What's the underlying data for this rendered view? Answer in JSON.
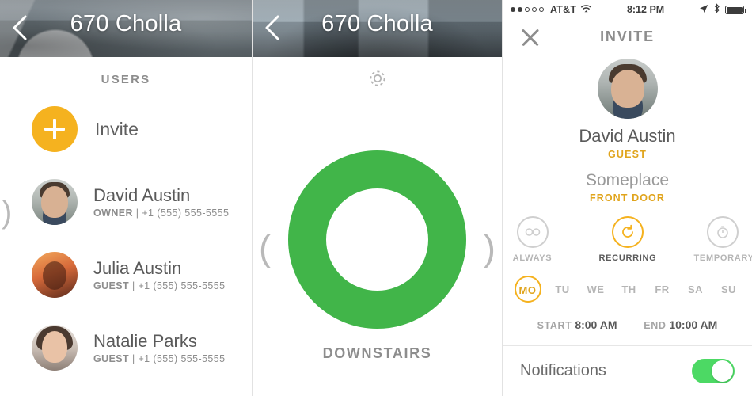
{
  "panel_left": {
    "header": {
      "title": "670 Cholla",
      "back_icon": "chevron-left-icon"
    },
    "section_title": "USERS",
    "invite": {
      "label": "Invite",
      "icon": "plus-icon"
    },
    "users": [
      {
        "name": "David Austin",
        "role": "OWNER",
        "separator": "|",
        "phone": "+1 (555) 555-5555"
      },
      {
        "name": "Julia Austin",
        "role": "GUEST",
        "separator": "|",
        "phone": "+1 (555) 555-5555"
      },
      {
        "name": "Natalie Parks",
        "role": "GUEST",
        "separator": "|",
        "phone": "+1 (555) 555-5555"
      }
    ],
    "edge_paren": ")"
  },
  "panel_mid": {
    "header": {
      "title": "670 Cholla",
      "back_icon": "chevron-left-icon"
    },
    "gear_icon": "gear-icon",
    "ring_color": "#41b549",
    "room_label": "DOWNSTAIRS",
    "paren_left": "(",
    "paren_right": ")"
  },
  "panel_right": {
    "status_bar": {
      "signal_dots": 5,
      "signal_filled": 2,
      "carrier": "AT&T",
      "wifi_icon": "wifi-icon",
      "time": "8:12 PM",
      "location_icon": "location-arrow-icon",
      "bluetooth_icon": "bluetooth-icon",
      "battery_icon": "battery-full-icon"
    },
    "title": "INVITE",
    "close_icon": "close-icon",
    "profile": {
      "name": "David Austin",
      "role": "GUEST",
      "avatar": "user-avatar"
    },
    "place": {
      "name": "Someplace",
      "door": "FRONT DOOR"
    },
    "modes": [
      {
        "label": "ALWAYS",
        "icon": "infinity-icon",
        "active": false
      },
      {
        "label": "RECURRING",
        "icon": "refresh-icon",
        "active": true
      },
      {
        "label": "TEMPORARY",
        "icon": "stopwatch-icon",
        "active": false
      }
    ],
    "days": [
      {
        "label": "MO",
        "active": true
      },
      {
        "label": "TU",
        "active": false
      },
      {
        "label": "WE",
        "active": false
      },
      {
        "label": "TH",
        "active": false
      },
      {
        "label": "FR",
        "active": false
      },
      {
        "label": "SA",
        "active": false
      },
      {
        "label": "SU",
        "active": false
      }
    ],
    "schedule": {
      "start_label": "START",
      "start_value": "8:00 AM",
      "end_label": "END",
      "end_value": "10:00 AM"
    },
    "notifications": {
      "label": "Notifications",
      "enabled": true,
      "color": "#4cd964"
    }
  }
}
